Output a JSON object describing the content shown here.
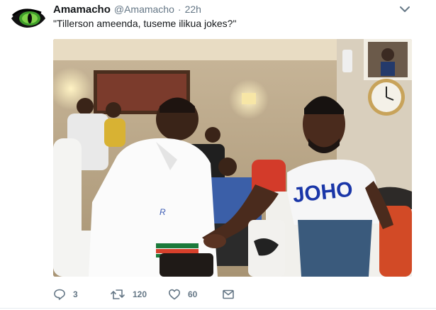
{
  "tweet": {
    "display_name": "Amamacho",
    "handle": "@Amamacho",
    "separator": "·",
    "time": "22h",
    "text": "\"Tillerson ameenda, tuseme ilikua jokes?\"",
    "avatar_icon": "green-eye-avatar-icon",
    "menu_icon": "chevron-down-icon"
  },
  "media": {
    "shirt_text": "JOHO",
    "sleeve_text": "R"
  },
  "actions": {
    "reply": {
      "icon": "reply-icon",
      "count": "3"
    },
    "retweet": {
      "icon": "retweet-icon",
      "count": "120"
    },
    "like": {
      "icon": "heart-icon",
      "count": "60"
    },
    "message": {
      "icon": "envelope-icon"
    }
  },
  "colors": {
    "text_primary": "#14171a",
    "text_secondary": "#657786",
    "action_gray": "#657786"
  }
}
